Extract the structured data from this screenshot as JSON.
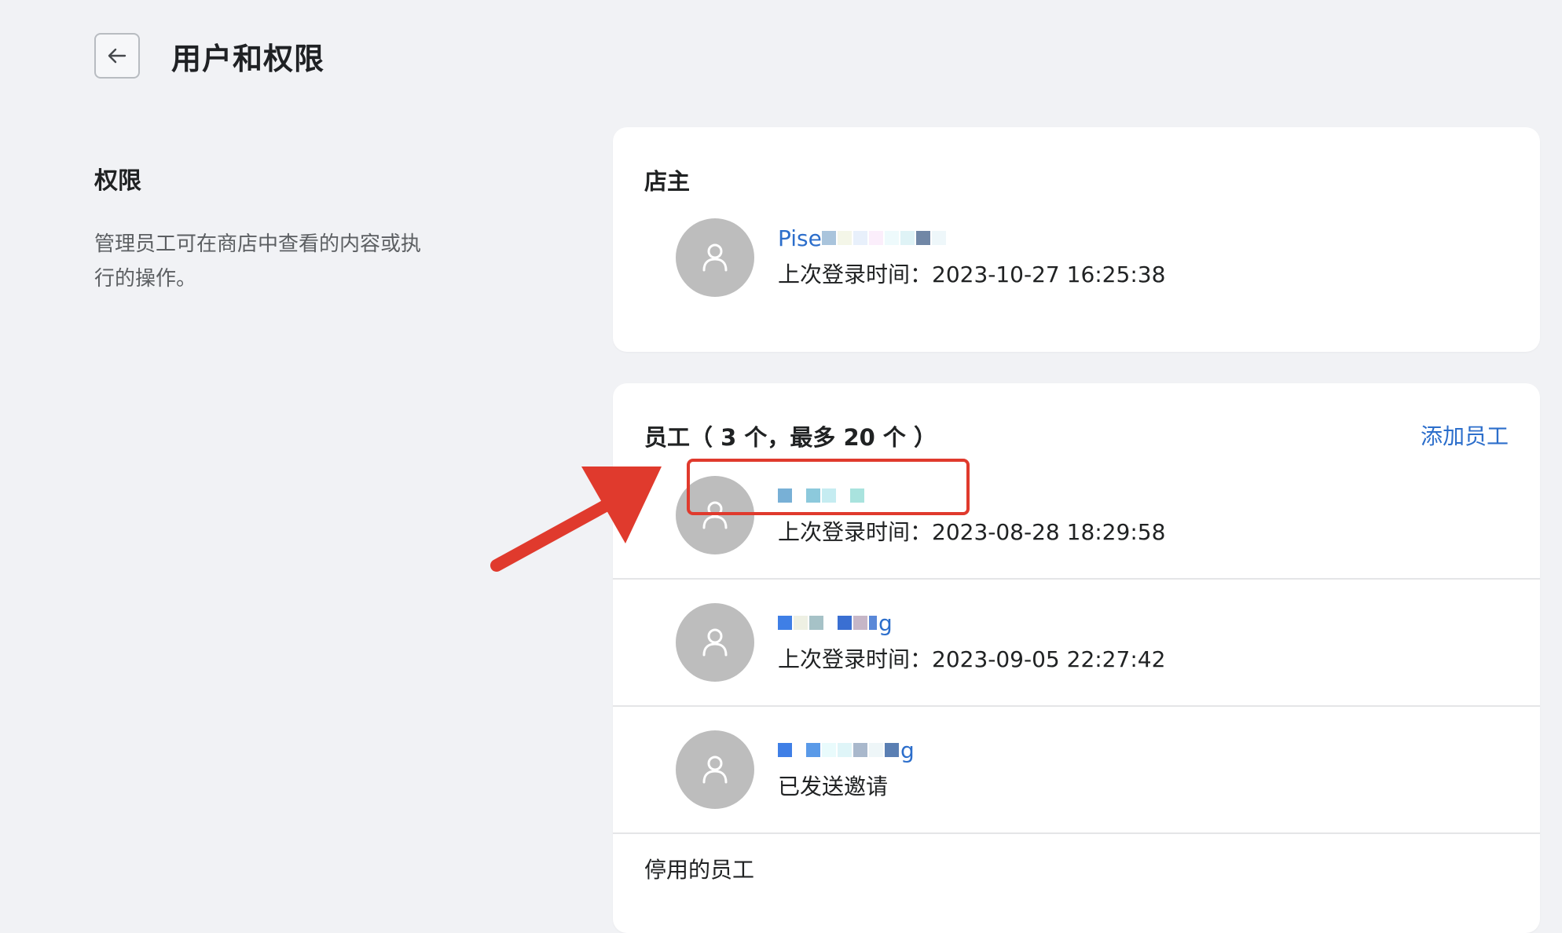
{
  "header": {
    "title": "用户和权限",
    "back_icon": "arrow-left-icon"
  },
  "permissions": {
    "title": "权限",
    "description": "管理员工可在商店中查看的内容或执行的操作。"
  },
  "owner_section": {
    "heading": "店主",
    "owner": {
      "name": "Pise",
      "last_login": "上次登录时间：2023-10-27 16:25:38"
    }
  },
  "staff_section": {
    "heading": "员工（ 3 个，最多 20 个 ）",
    "add_label": "添加员工",
    "members": [
      {
        "name": "",
        "status": "上次登录时间：2023-08-28 18:29:58"
      },
      {
        "name": "g",
        "status": "上次登录时间：2023-09-05 22:27:42"
      },
      {
        "name": "g",
        "status": "已发送邀请"
      }
    ],
    "disabled_label": "停用的员工"
  },
  "colors": {
    "background": "#f1f2f5",
    "link": "#2c6ecb",
    "annotation": "#e03a2d",
    "avatar": "#bdbdbd"
  }
}
